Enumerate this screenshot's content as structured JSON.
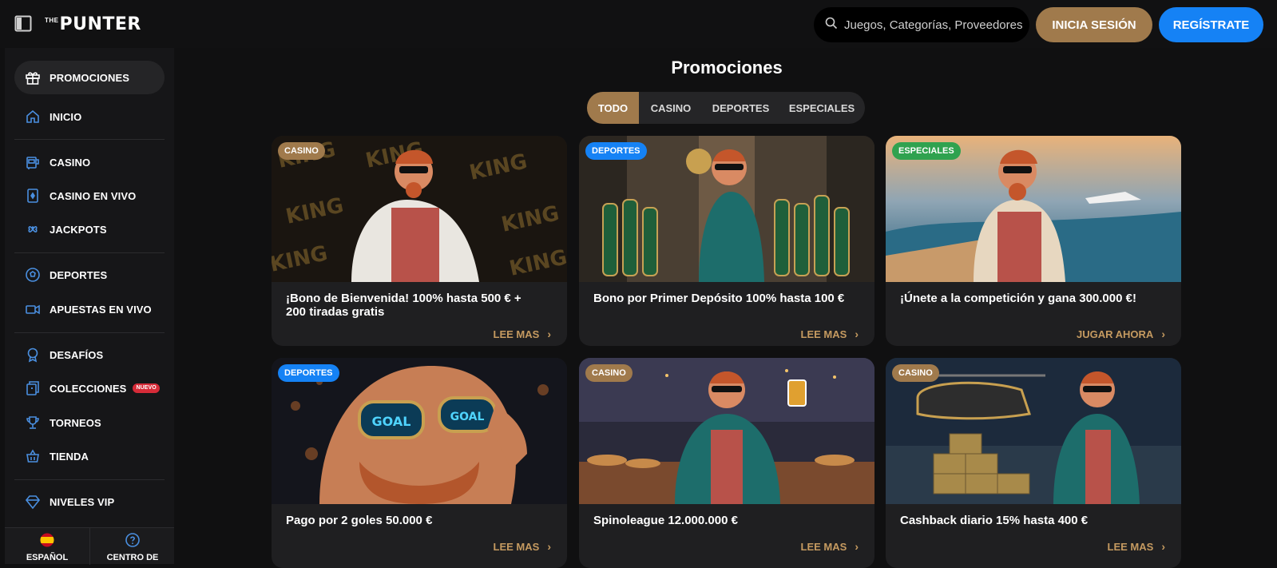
{
  "header": {
    "logo_small": "THE",
    "logo_main": "PUNTER",
    "search_placeholder": "Juegos, Categorías, Proveedores",
    "login_label": "INICIA SESIÓN",
    "register_label": "REGÍSTRATE"
  },
  "sidebar": {
    "items": [
      {
        "label": "PROMOCIONES",
        "icon": "gift-icon"
      },
      {
        "label": "INICIO",
        "icon": "home-icon"
      },
      {
        "label": "CASINO",
        "icon": "slot-machine-icon"
      },
      {
        "label": "CASINO EN VIVO",
        "icon": "card-icon"
      },
      {
        "label": "JACKPOTS",
        "icon": "clover-icon"
      },
      {
        "label": "DEPORTES",
        "icon": "soccer-ball-icon"
      },
      {
        "label": "APUESTAS EN VIVO",
        "icon": "video-icon"
      },
      {
        "label": "DESAFÍOS",
        "icon": "badge-icon"
      },
      {
        "label": "COLECCIONES",
        "icon": "collection-icon"
      },
      {
        "label": "TORNEOS",
        "icon": "trophy-icon"
      },
      {
        "label": "TIENDA",
        "icon": "basket-icon"
      },
      {
        "label": "NIVELES VIP",
        "icon": "diamond-icon"
      }
    ],
    "new_badge": "NUEVO",
    "language_label": "ESPAÑOL",
    "help_label": "CENTRO DE"
  },
  "main": {
    "title": "Promociones",
    "tabs": [
      "TODO",
      "CASINO",
      "DEPORTES",
      "ESPECIALES"
    ],
    "cards": [
      {
        "tag": "CASINO",
        "tag_type": "casino",
        "title": "¡Bono de Bienvenida! 100% hasta 500 € + 200 tiradas gratis",
        "cta": "LEE MAS"
      },
      {
        "tag": "DEPORTES",
        "tag_type": "deportes",
        "title": "Bono por Primer Depósito 100% hasta 100 €",
        "cta": "LEE MAS"
      },
      {
        "tag": "ESPECIALES",
        "tag_type": "especiales",
        "title": "¡Únete a la competición y gana 300.000 €!",
        "cta": "JUGAR AHORA"
      },
      {
        "tag": "DEPORTES",
        "tag_type": "deportes",
        "title": "Pago por 2 goles 50.000 €",
        "cta": "LEE MAS"
      },
      {
        "tag": "CASINO",
        "tag_type": "casino",
        "title": "Spinoleague 12.000.000 €",
        "cta": "LEE MAS"
      },
      {
        "tag": "CASINO",
        "tag_type": "casino",
        "title": "Cashback diario 15% hasta 400 €",
        "cta": "LEE MAS"
      }
    ]
  },
  "colors": {
    "accent_gold": "#a07a4c",
    "accent_blue": "#1582f5",
    "accent_green": "#2fa24f"
  }
}
